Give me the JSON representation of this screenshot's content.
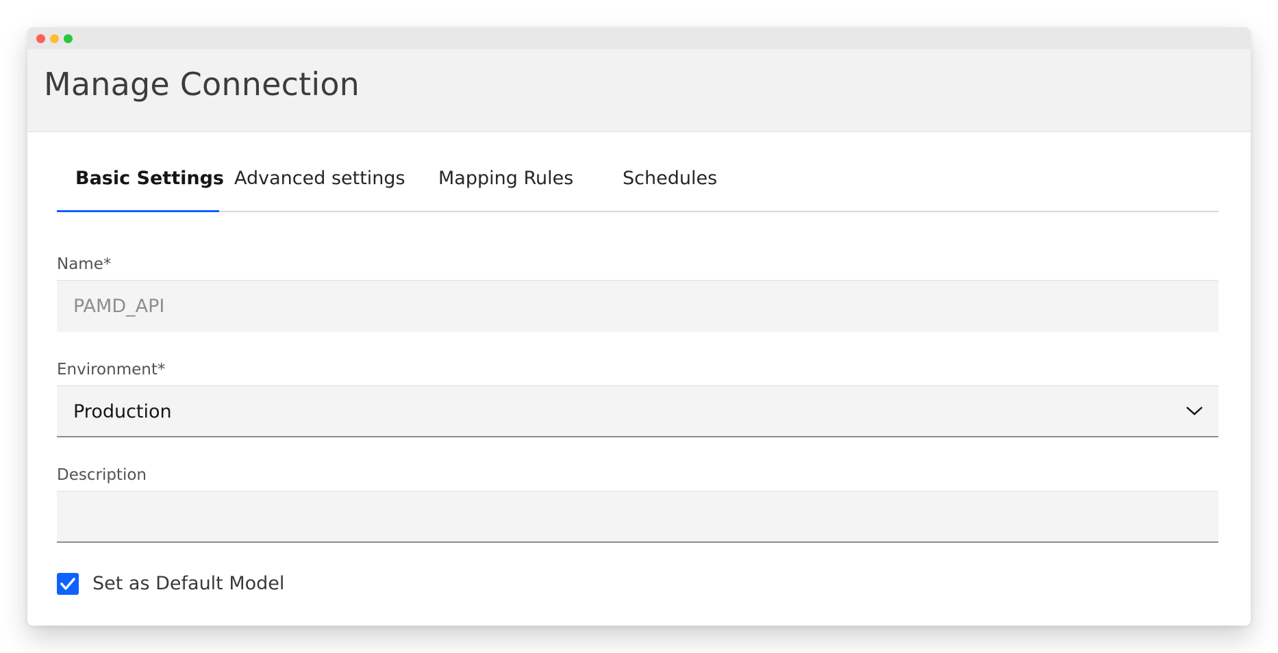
{
  "window": {
    "title": "Manage Connection"
  },
  "tabs": [
    {
      "label": "Basic Settings",
      "active": true
    },
    {
      "label": "Advanced settings",
      "active": false
    },
    {
      "label": "Mapping Rules",
      "active": false
    },
    {
      "label": "Schedules",
      "active": false
    }
  ],
  "form": {
    "name": {
      "label": "Name*",
      "value": "PAMD_API"
    },
    "environment": {
      "label": "Environment*",
      "selected": "Production"
    },
    "description": {
      "label": "Description",
      "value": ""
    },
    "default_model": {
      "label": "Set as Default Model",
      "checked": true
    }
  },
  "colors": {
    "accent": "#0f62fe",
    "header_bg": "#f2f2f2",
    "field_bg": "#f4f4f4"
  },
  "icons": {
    "environment_dropdown": "chevron-down-icon",
    "default_model_checkbox": "checkmark-icon"
  }
}
